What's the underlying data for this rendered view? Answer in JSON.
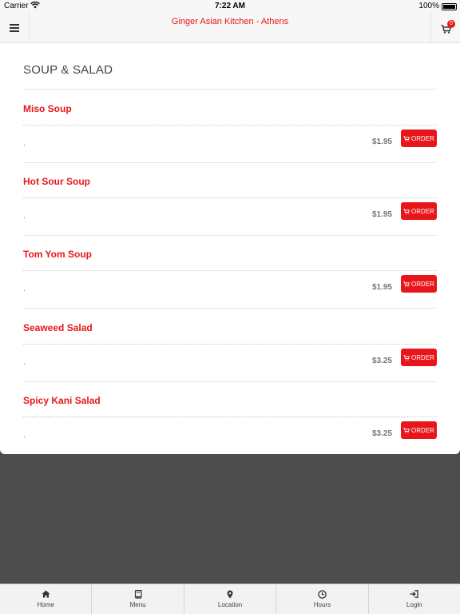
{
  "status_bar": {
    "carrier": "Carrier",
    "time": "7:22 AM",
    "battery": "100%"
  },
  "header": {
    "title": "Ginger Asian Kitchen - Athens",
    "cart_count": "0"
  },
  "section": {
    "title": "SOUP & SALAD"
  },
  "items": [
    {
      "name": "Miso Soup",
      "description": ".",
      "price": "$1.95",
      "order_label": "ORDER"
    },
    {
      "name": "Hot Sour Soup",
      "description": ".",
      "price": "$1.95",
      "order_label": "ORDER"
    },
    {
      "name": "Tom Yom Soup",
      "description": ".",
      "price": "$1.95",
      "order_label": "ORDER"
    },
    {
      "name": "Seaweed Salad",
      "description": ".",
      "price": "$3.25",
      "order_label": "ORDER"
    },
    {
      "name": "Spicy Kani Salad",
      "description": ".",
      "price": "$3.25",
      "order_label": "ORDER"
    }
  ],
  "tabs": [
    {
      "label": "Home",
      "icon": "home-icon"
    },
    {
      "label": "Menu",
      "icon": "book-icon"
    },
    {
      "label": "Location",
      "icon": "map-pin-icon"
    },
    {
      "label": "Hours",
      "icon": "clock-icon"
    },
    {
      "label": "Login",
      "icon": "sign-in-icon"
    }
  ],
  "colors": {
    "brand_red": "#e8161a",
    "backdrop": "#4d4d4d"
  }
}
